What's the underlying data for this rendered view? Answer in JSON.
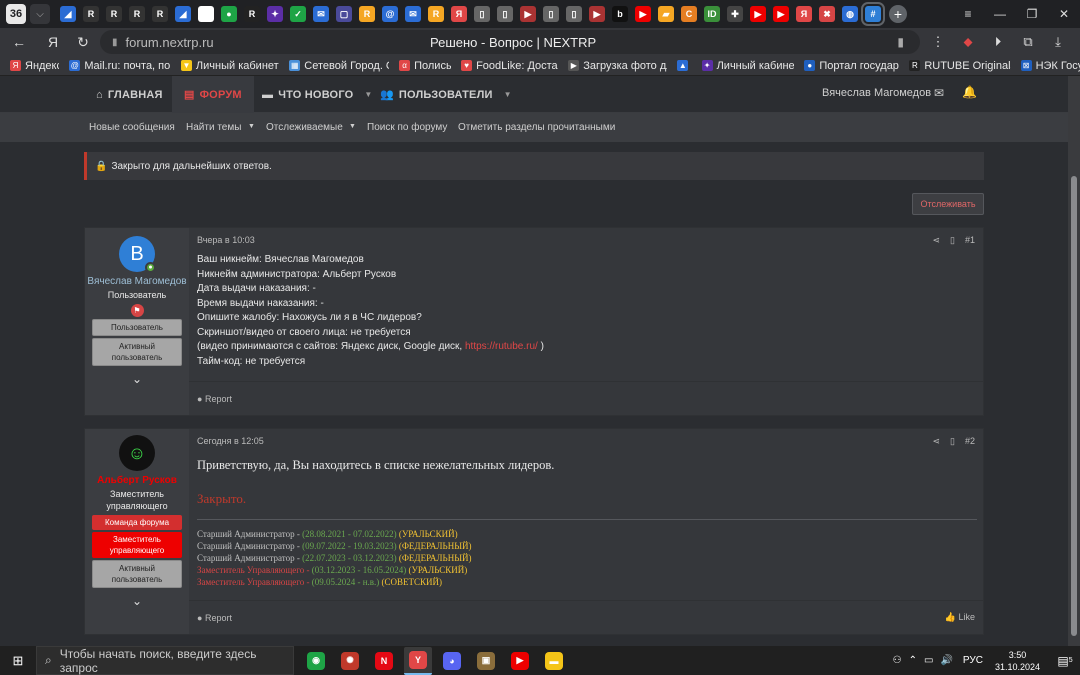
{
  "browser": {
    "tab_count": "36",
    "tab_favicons": [
      {
        "name": "tab-icon-1",
        "color": "#2b6cd4",
        "glyph": "◢"
      },
      {
        "name": "tab-icon-2",
        "color": "#333",
        "glyph": "R"
      },
      {
        "name": "tab-icon-3",
        "color": "#333",
        "glyph": "R"
      },
      {
        "name": "tab-icon-4",
        "color": "#333",
        "glyph": "R"
      },
      {
        "name": "tab-icon-5",
        "color": "#333",
        "glyph": "R"
      },
      {
        "name": "tab-icon-6",
        "color": "#2b6cd4",
        "glyph": "◢"
      },
      {
        "name": "tab-icon-7",
        "color": "#fff",
        "glyph": "G"
      },
      {
        "name": "tab-icon-8",
        "color": "#1ea446",
        "glyph": "●"
      },
      {
        "name": "tab-icon-9",
        "color": "#222",
        "glyph": "R"
      },
      {
        "name": "tab-icon-10",
        "color": "#5b2ea6",
        "glyph": "✦"
      },
      {
        "name": "tab-icon-11",
        "color": "#1ea446",
        "glyph": "✓"
      },
      {
        "name": "tab-icon-12",
        "color": "#2b6cd4",
        "glyph": "✉"
      },
      {
        "name": "tab-icon-13",
        "color": "#4a4a9a",
        "glyph": "▢"
      },
      {
        "name": "tab-icon-14",
        "color": "#f5a623",
        "glyph": "R"
      },
      {
        "name": "tab-icon-15",
        "color": "#2b6cd4",
        "glyph": "@"
      },
      {
        "name": "tab-icon-16",
        "color": "#2b6cd4",
        "glyph": "✉"
      },
      {
        "name": "tab-icon-17",
        "color": "#f5a623",
        "glyph": "R"
      },
      {
        "name": "tab-icon-18",
        "color": "#e04747",
        "glyph": "Я"
      },
      {
        "name": "tab-icon-19",
        "color": "#666",
        "glyph": "▯"
      },
      {
        "name": "tab-icon-20",
        "color": "#666",
        "glyph": "▯"
      },
      {
        "name": "tab-icon-21",
        "color": "#a33",
        "glyph": "▶"
      },
      {
        "name": "tab-icon-22",
        "color": "#666",
        "glyph": "▯"
      },
      {
        "name": "tab-icon-23",
        "color": "#666",
        "glyph": "▯"
      },
      {
        "name": "tab-icon-24",
        "color": "#a33",
        "glyph": "▶"
      },
      {
        "name": "tab-icon-25",
        "color": "#111",
        "glyph": "b"
      },
      {
        "name": "tab-icon-26",
        "color": "#e00",
        "glyph": "▶"
      },
      {
        "name": "tab-icon-27",
        "color": "#f5a623",
        "glyph": "▰"
      },
      {
        "name": "tab-icon-28",
        "color": "#e67e22",
        "glyph": "C"
      },
      {
        "name": "tab-icon-29",
        "color": "#3a8f3a",
        "glyph": "ID"
      },
      {
        "name": "tab-icon-30",
        "color": "#444",
        "glyph": "✚"
      },
      {
        "name": "tab-icon-31",
        "color": "#e00",
        "glyph": "▶"
      },
      {
        "name": "tab-icon-32",
        "color": "#e00",
        "glyph": "▶"
      },
      {
        "name": "tab-icon-33",
        "color": "#e04747",
        "glyph": "Я"
      },
      {
        "name": "tab-icon-34",
        "color": "#d64545",
        "glyph": "✖"
      },
      {
        "name": "tab-icon-35",
        "color": "#2b6cd4",
        "glyph": "◍"
      },
      {
        "name": "tab-icon-36",
        "color": "#2f7fd6",
        "glyph": "#"
      }
    ],
    "url": "forum.nextrp.ru",
    "page_title": "Решено - Вопрос | NEXTRP",
    "bookmarks": [
      {
        "label": "Яндекс",
        "color": "#e04747",
        "glyph": "Я"
      },
      {
        "label": "Mail.ru: почта, пои",
        "color": "#2b6cd4",
        "glyph": "@"
      },
      {
        "label": "Личный кабинет |",
        "color": "#f5c518",
        "glyph": "▼"
      },
      {
        "label": "Сетевой Город. О",
        "color": "#4a90d9",
        "glyph": "▦"
      },
      {
        "label": "Полисы",
        "color": "#e04747",
        "glyph": "α"
      },
      {
        "label": "FoodLike: Достав",
        "color": "#e04747",
        "glyph": "♥"
      },
      {
        "label": "Загрузка фото дл",
        "color": "#555",
        "glyph": "▶"
      },
      {
        "label": "",
        "color": "#2b6cd4",
        "glyph": "▲"
      },
      {
        "label": "Личный кабинет",
        "color": "#5b2ea6",
        "glyph": "✦"
      },
      {
        "label": "Портал государс",
        "color": "#1f5fbf",
        "glyph": "●"
      },
      {
        "label": "RUTUBE Originals",
        "color": "#222",
        "glyph": "R"
      },
      {
        "label": "НЭК Госу",
        "color": "#1f5fbf",
        "glyph": "⊠"
      }
    ]
  },
  "forum": {
    "nav": {
      "home": "ГЛАВНАЯ",
      "forum": "ФОРУМ",
      "whats_new": "ЧТО НОВОГО",
      "users": "ПОЛЬЗОВАТЕЛИ",
      "username": "Вячеслав Магомедов"
    },
    "subnav": [
      "Новые сообщения",
      "Найти темы",
      "Отслеживаемые",
      "Поиск по форуму",
      "Отметить разделы прочитанными"
    ],
    "notice": "Закрыто для дальнейших ответов.",
    "follow_button": "Отслеживать",
    "post1": {
      "avatar_letter": "В",
      "author": "Вячеслав Магомедов",
      "user_title": "Пользователь",
      "banners": [
        "Пользователь",
        "Активный пользователь"
      ],
      "date": "Вчера в 10:03",
      "number": "#1",
      "lines": [
        "Ваш никнейм: Вячеслав Магомедов",
        "Никнейм администратора: Альберт Русков",
        "Дата выдачи наказания: -",
        "Время выдачи наказания: -",
        "Опишите жалобу: Нахожусь ли я в ЧС лидеров?",
        "Скриншот/видео от своего лица: не требуется"
      ],
      "line7_prefix": "(видео принимаются с сайтов: Яндекс диск, Google диск, ",
      "line7_link": "https://rutube.ru/",
      "line7_suffix": " )",
      "line8": "Тайм-код: не требуется",
      "report": "Report"
    },
    "post2": {
      "author": "Альберт Русков",
      "user_title": "Заместитель управляющего",
      "banners": [
        "Команда форума",
        "Заместитель управляющего",
        "Активный пользователь"
      ],
      "date": "Сегодня в 12:05",
      "number": "#2",
      "greeting": "Приветствую, да, Вы находитесь в списке нежелательных лидеров.",
      "closed": "Закрыто.",
      "roles": [
        {
          "title": "Старший Администратор - ",
          "dates": "(28.08.2021 - 07.02.2022)",
          "sub": " (УРАЛЬСКИЙ)",
          "red": false
        },
        {
          "title": "Старший Администратор - ",
          "dates": "(09.07.2022 - 19.03.2023)",
          "sub": " (ФЕДЕРАЛЬНЫЙ)",
          "red": false
        },
        {
          "title": "Старший Администратор - ",
          "dates": "(22.07.2023 - 03.12.2023)",
          "sub": " (ФЕДЕРАЛЬНЫЙ)",
          "red": false
        },
        {
          "title": "Заместитель Управляющего - ",
          "dates": "(03.12.2023 - 16.05.2024)",
          "sub": " (УРАЛЬСКИЙ)",
          "red": true
        },
        {
          "title": "Заместитель Управляющего - ",
          "dates": "(09.05.2024 - н.в.)",
          "sub": " (СОВЕТСКИЙ)",
          "red": true
        }
      ],
      "report": "Report",
      "like": "Like"
    }
  },
  "taskbar": {
    "search_placeholder": "Чтобы начать поиск, введите здесь запрос",
    "apps": [
      {
        "name": "chrome-app",
        "color": "#1ea446",
        "glyph": "◉"
      },
      {
        "name": "game-app",
        "color": "#c0392b",
        "glyph": "✺"
      },
      {
        "name": "netflix-app",
        "color": "#e50914",
        "glyph": "N"
      },
      {
        "name": "yandex-browser-app",
        "color": "#e04747",
        "glyph": "Y"
      },
      {
        "name": "discord-app",
        "color": "#5865f2",
        "glyph": "◕"
      },
      {
        "name": "photo-app",
        "color": "#8a6d3b",
        "glyph": "▣"
      },
      {
        "name": "youtube-app",
        "color": "#e00",
        "glyph": "▶"
      },
      {
        "name": "explorer-app",
        "color": "#f5c518",
        "glyph": "▬"
      }
    ],
    "lang": "РУС",
    "time": "3:50",
    "date": "31.10.2024",
    "notif_count": "5"
  }
}
